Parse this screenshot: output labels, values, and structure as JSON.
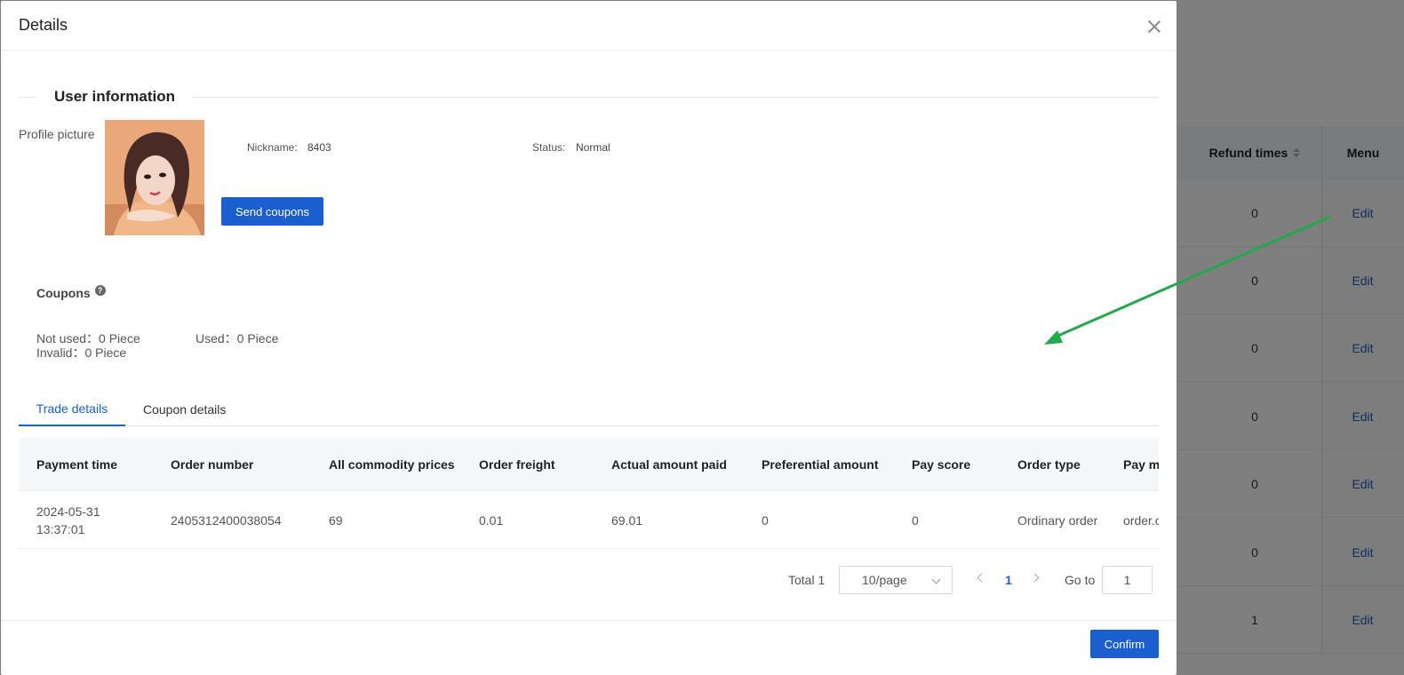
{
  "background_table": {
    "col_refund": "Refund times",
    "col_menu": "Menu",
    "rows": [
      {
        "refund": "0",
        "action": "Edit"
      },
      {
        "refund": "0",
        "action": "Edit"
      },
      {
        "refund": "0",
        "action": "Edit"
      },
      {
        "refund": "0",
        "action": "Edit"
      },
      {
        "refund": "0",
        "action": "Edit"
      },
      {
        "refund": "0",
        "action": "Edit"
      },
      {
        "refund": "1",
        "action": "Edit"
      }
    ]
  },
  "modal": {
    "title": "Details",
    "section_title": "User information",
    "profile_label": "Profile picture",
    "nickname_label": "Nickname:",
    "nickname_value": "8403",
    "status_label": "Status:",
    "status_value": "Normal",
    "send_coupons": "Send coupons",
    "coupons_title": "Coupons",
    "help_icon": "?",
    "coupon_stats": {
      "not_used": "Not used：0  Piece",
      "used": "Used：0  Piece",
      "invalid": "Invalid：0  Piece"
    },
    "tabs": [
      "Trade details",
      "Coupon details"
    ],
    "table": {
      "headers": [
        "Payment time",
        "Order number",
        "All commodity prices",
        "Order freight",
        "Actual amount paid",
        "Preferential amount",
        "Pay score",
        "Order type",
        "Pay m"
      ],
      "rows": [
        [
          "2024-05-31 13:37:01",
          "2405312400038054",
          "69",
          "0.01",
          "69.01",
          "0",
          "0",
          "Ordinary order",
          "order.c"
        ]
      ]
    },
    "pagination": {
      "total": "Total 1",
      "page_size": "10/page",
      "current_page": "1",
      "goto_label": "Go to",
      "goto_value": "1"
    },
    "confirm": "Confirm"
  },
  "colors": {
    "primary": "#1a5ecf",
    "annotation_arrow": "#22a94a"
  }
}
